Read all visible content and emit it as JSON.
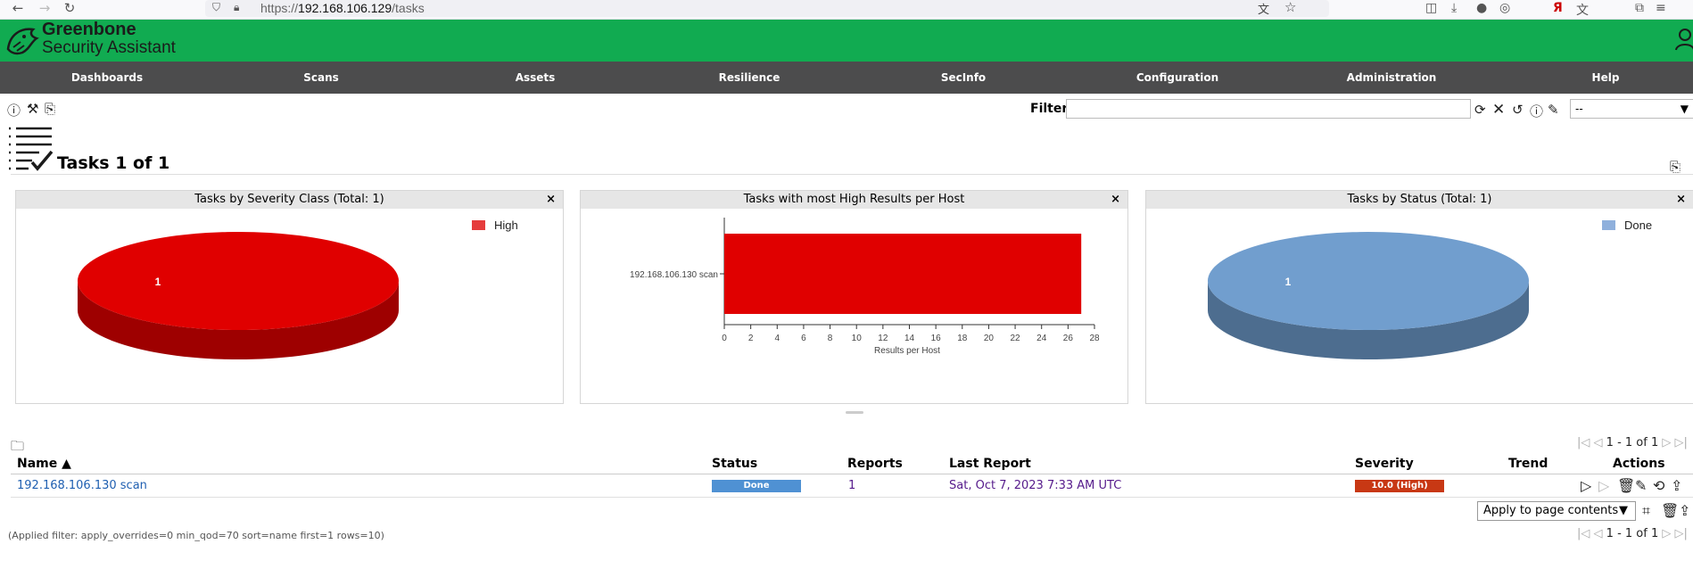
{
  "browser": {
    "url_prefix": "https://",
    "url_host": "192.168.106.129",
    "url_path": "/tasks"
  },
  "app": {
    "brand_title": "Greenbone",
    "brand_subtitle": "Security Assistant"
  },
  "menu": [
    "Dashboards",
    "Scans",
    "Assets",
    "Resilience",
    "SecInfo",
    "Configuration",
    "Administration",
    "Help"
  ],
  "toolbar": {
    "filter_label": "Filter",
    "filter_value": "",
    "filter_select_value": "--"
  },
  "page": {
    "title": "Tasks 1 of 1"
  },
  "panels": [
    {
      "title": "Tasks by Severity Class (Total: 1)",
      "close": "×"
    },
    {
      "title": "Tasks with most High Results per Host",
      "close": "×"
    },
    {
      "title": "Tasks by Status (Total: 1)",
      "close": "×"
    }
  ],
  "chart_data": [
    {
      "type": "pie",
      "title": "Tasks by Severity Class (Total: 1)",
      "slices": [
        {
          "label": "High",
          "value": 1,
          "color": "#e00000",
          "shade": "#9e0000"
        }
      ],
      "legend": [
        {
          "label": "High",
          "color": "#e53c3c"
        }
      ],
      "legend_position": "top-right"
    },
    {
      "type": "bar",
      "orientation": "horizontal",
      "title": "Tasks with most High Results per Host",
      "categories": [
        "192.168.106.130 scan"
      ],
      "values": [
        27
      ],
      "xlabel": "Results per Host",
      "xlim": [
        0,
        28
      ],
      "xticks": [
        0,
        2,
        4,
        6,
        8,
        10,
        12,
        14,
        16,
        18,
        20,
        22,
        24,
        26,
        28
      ],
      "bar_color": "#e00000"
    },
    {
      "type": "pie",
      "title": "Tasks by Status (Total: 1)",
      "slices": [
        {
          "label": "Done",
          "value": 1,
          "color": "#719ece",
          "shade": "#4d6d8f"
        }
      ],
      "legend": [
        {
          "label": "Done",
          "color": "#8fb0dc"
        }
      ],
      "legend_position": "top-right"
    }
  ],
  "table": {
    "pager_text": "1 - 1 of 1",
    "columns": [
      "Name ▲",
      "Status",
      "Reports",
      "Last Report",
      "Severity",
      "Trend",
      "Actions"
    ],
    "rows": [
      {
        "name": "192.168.106.130 scan",
        "status": "Done",
        "status_progress": 1.0,
        "reports": "1",
        "last_report": "Sat, Oct 7, 2023 7:33 AM UTC",
        "severity": "10.0 (High)",
        "severity_score": 10.0,
        "trend": ""
      }
    ],
    "bulk_action": "Apply to page contents",
    "applied_filter": "(Applied filter: apply_overrides=0 min_qod=70 sort=name first=1 rows=10)"
  }
}
